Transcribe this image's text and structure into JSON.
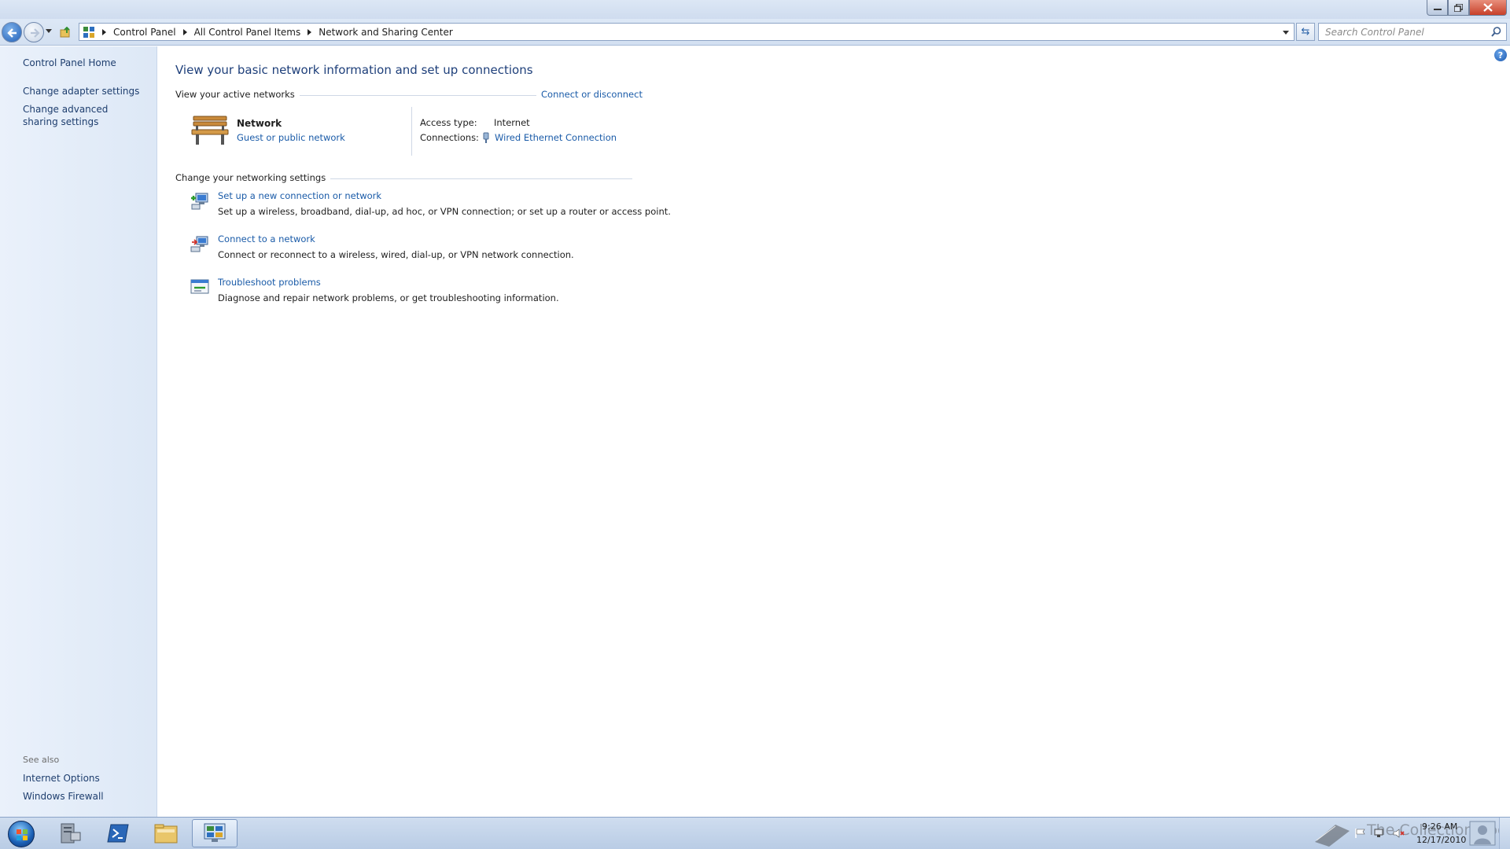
{
  "navbar": {
    "breadcrumbs": [
      "Control Panel",
      "All Control Panel Items",
      "Network and Sharing Center"
    ],
    "search_placeholder": "Search Control Panel"
  },
  "left_panel": {
    "home": "Control Panel Home",
    "links": [
      "Change adapter settings",
      "Change advanced sharing settings"
    ],
    "see_also_label": "See also",
    "see_also": [
      "Internet Options",
      "Windows Firewall"
    ]
  },
  "main": {
    "title": "View your basic network information and set up connections",
    "active_networks_label": "View your active networks",
    "connect_link": "Connect or disconnect",
    "network": {
      "name": "Network",
      "type": "Guest or public network",
      "access_type_label": "Access type:",
      "access_type_value": "Internet",
      "connections_label": "Connections:",
      "connections_value": "Wired Ethernet Connection"
    },
    "change_settings_label": "Change your networking settings",
    "tasks": [
      {
        "title": "Set up a new connection or network",
        "desc": "Set up a wireless, broadband, dial-up, ad hoc, or VPN connection; or set up a router or access point.",
        "icon": "new-connection-icon"
      },
      {
        "title": "Connect to a network",
        "desc": "Connect or reconnect to a wireless, wired, dial-up, or VPN network connection.",
        "icon": "connect-network-icon"
      },
      {
        "title": "Troubleshoot problems",
        "desc": "Diagnose and repair network problems, or get troubleshooting information.",
        "icon": "troubleshoot-icon"
      }
    ]
  },
  "taskbar": {
    "apps": [
      "server-manager-icon",
      "powershell-icon",
      "explorer-folder-icon",
      "control-panel-icon"
    ],
    "clock_time": "9:26 AM",
    "clock_date": "12/17/2010",
    "watermark": "The Collection Book"
  },
  "colors": {
    "link": "#1a5ba8",
    "title": "#1e3f7a",
    "left_panel": "#dde8f6",
    "close_button": "#c7402a"
  }
}
